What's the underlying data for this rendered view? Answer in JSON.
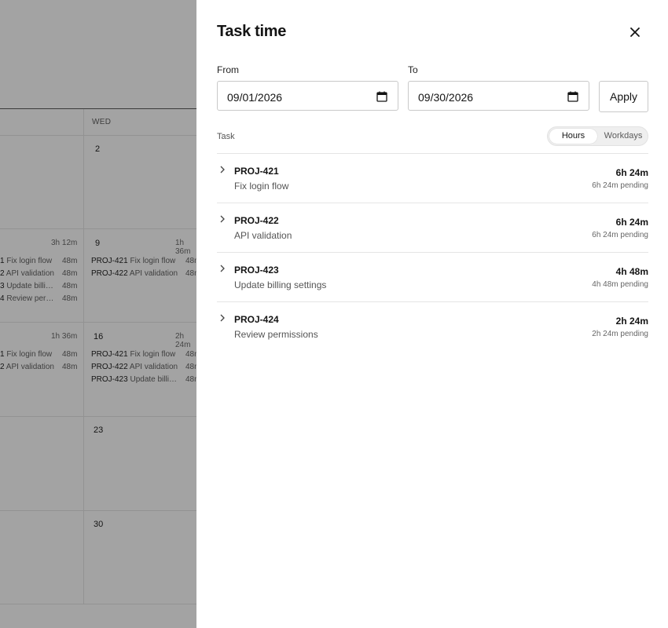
{
  "calendar": {
    "header_wed": "WED",
    "days": [
      {
        "num": "2"
      },
      {
        "num": "9",
        "total": "1h 36m"
      },
      {
        "num": "16",
        "total": "2h 24m"
      },
      {
        "num": "23"
      },
      {
        "num": "30"
      }
    ],
    "left_totals": [
      "3h 12m",
      "1h 36m"
    ],
    "left_week2": [
      {
        "key": "1",
        "title": "Fix login flow",
        "dur": "48m"
      },
      {
        "key": "2",
        "title": "API validation",
        "dur": "48m"
      },
      {
        "key": "3",
        "title": "Update billi…",
        "dur": "48m"
      },
      {
        "key": "4",
        "title": "Review per…",
        "dur": "48m"
      }
    ],
    "left_week3": [
      {
        "key": "1",
        "title": "Fix login flow",
        "dur": "48m"
      },
      {
        "key": "2",
        "title": "API validation",
        "dur": "48m"
      }
    ],
    "wed_week2": [
      {
        "key": "PROJ-421",
        "title": "Fix login flow",
        "dur": "48m"
      },
      {
        "key": "PROJ-422",
        "title": "API validation",
        "dur": "48m"
      }
    ],
    "wed_week3": [
      {
        "key": "PROJ-421",
        "title": "Fix login flow",
        "dur": "48m"
      },
      {
        "key": "PROJ-422",
        "title": "API validation",
        "dur": "48m"
      },
      {
        "key": "PROJ-423",
        "title": "Update billi…",
        "dur": "48m"
      }
    ]
  },
  "drawer": {
    "title": "Task time",
    "from_label": "From",
    "to_label": "To",
    "from_value": "09/01/2026",
    "to_value": "09/30/2026",
    "apply_label": "Apply",
    "task_column": "Task",
    "toggle": {
      "hours": "Hours",
      "workdays": "Workdays",
      "selected": "Hours"
    },
    "tasks": [
      {
        "key": "PROJ-421",
        "name": "Fix login flow",
        "time": "6h 24m",
        "pending": "6h 24m pending"
      },
      {
        "key": "PROJ-422",
        "name": "API validation",
        "time": "6h 24m",
        "pending": "6h 24m pending"
      },
      {
        "key": "PROJ-423",
        "name": "Update billing settings",
        "time": "4h 48m",
        "pending": "4h 48m pending"
      },
      {
        "key": "PROJ-424",
        "name": "Review permissions",
        "time": "2h 24m",
        "pending": "2h 24m pending"
      }
    ]
  },
  "icons": {
    "close": "close-icon",
    "calendar": "calendar-icon",
    "chevron": "chevron-right-icon"
  }
}
